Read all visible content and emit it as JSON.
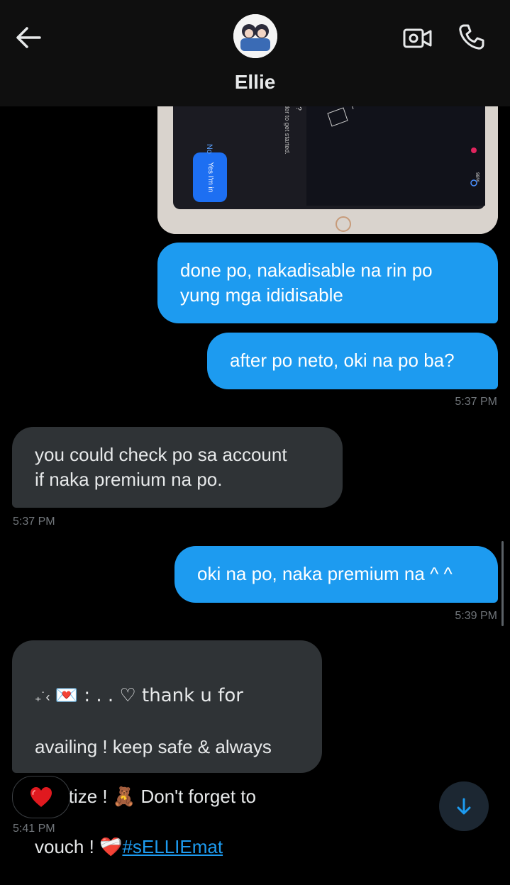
{
  "header": {
    "contact_name": "Ellie",
    "icons": [
      "back-arrow-icon",
      "video-camera-icon",
      "phone-icon"
    ]
  },
  "attachment": {
    "ui_texts": [
      "No",
      "Yes I'm in",
      "nder to get started.",
      "ile?",
      "n",
      "98%"
    ]
  },
  "messages": [
    {
      "from": "me",
      "text": "done po, nakadisable na rin po\nyung mga ididisable"
    },
    {
      "from": "me",
      "text": "after po neto, oki na po ba?",
      "time": "5:37 PM"
    },
    {
      "from": "them",
      "text": "you could check po sa account\nif naka premium na po.",
      "time": "5:37 PM"
    },
    {
      "from": "me",
      "text": "oki na po, naka premium na ^ ^",
      "time": "5:39 PM"
    },
    {
      "from": "them",
      "line1": "₊˙‹",
      "line1b": "💌 : . . ♡ thank u for",
      "line2": "availing !  keep safe & always",
      "line3a": "sanitize !",
      "line3b": "🧸",
      "line3c": "Don't forget to",
      "line4a": "vouch !",
      "line4b": "❤️‍🩹",
      "hashtag": "#sELLIEmat",
      "time": "5:41 PM"
    }
  ],
  "reaction": {
    "emoji": "❤️"
  },
  "colors": {
    "outgoing": "#1d9bf0",
    "incoming": "#2f3336",
    "background": "#000000"
  }
}
